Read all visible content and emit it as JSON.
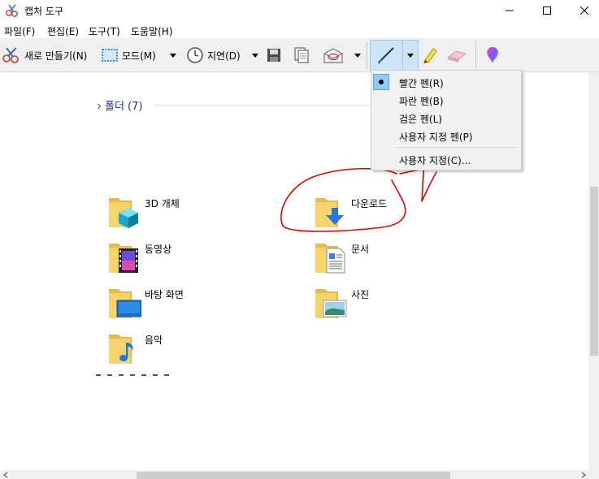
{
  "window": {
    "title": "캡처 도구"
  },
  "menu": {
    "items": [
      "파일(F)",
      "편집(E)",
      "도구(T)",
      "도움말(H)"
    ]
  },
  "toolbar": {
    "new_label": "새로 만들기(N)",
    "mode_label": "모드(M)",
    "delay_label": "지연(D)"
  },
  "pen_menu": {
    "items": [
      {
        "label": "빨간 펜(R)",
        "selected": true
      },
      {
        "label": "파란 펜(B)",
        "selected": false
      },
      {
        "label": "검은 펜(L)",
        "selected": false
      },
      {
        "label": "사용자 지정 펜(P)",
        "selected": false
      }
    ],
    "customize_label": "사용자 지정(C)..."
  },
  "content": {
    "group_title": "폴더 (7)",
    "folders": [
      {
        "name": "3D 개체",
        "icon": "3d-objects-icon"
      },
      {
        "name": "다운로드",
        "icon": "downloads-icon"
      },
      {
        "name": "동영상",
        "icon": "videos-icon"
      },
      {
        "name": "문서",
        "icon": "documents-icon"
      },
      {
        "name": "바탕 화면",
        "icon": "desktop-icon"
      },
      {
        "name": "사진",
        "icon": "pictures-icon"
      },
      {
        "name": "음악",
        "icon": "music-icon"
      }
    ]
  },
  "colors": {
    "accent": "#cce4f7",
    "ink": "#e00000",
    "group_title": "#1e3287",
    "folder": "#f6d36b"
  }
}
